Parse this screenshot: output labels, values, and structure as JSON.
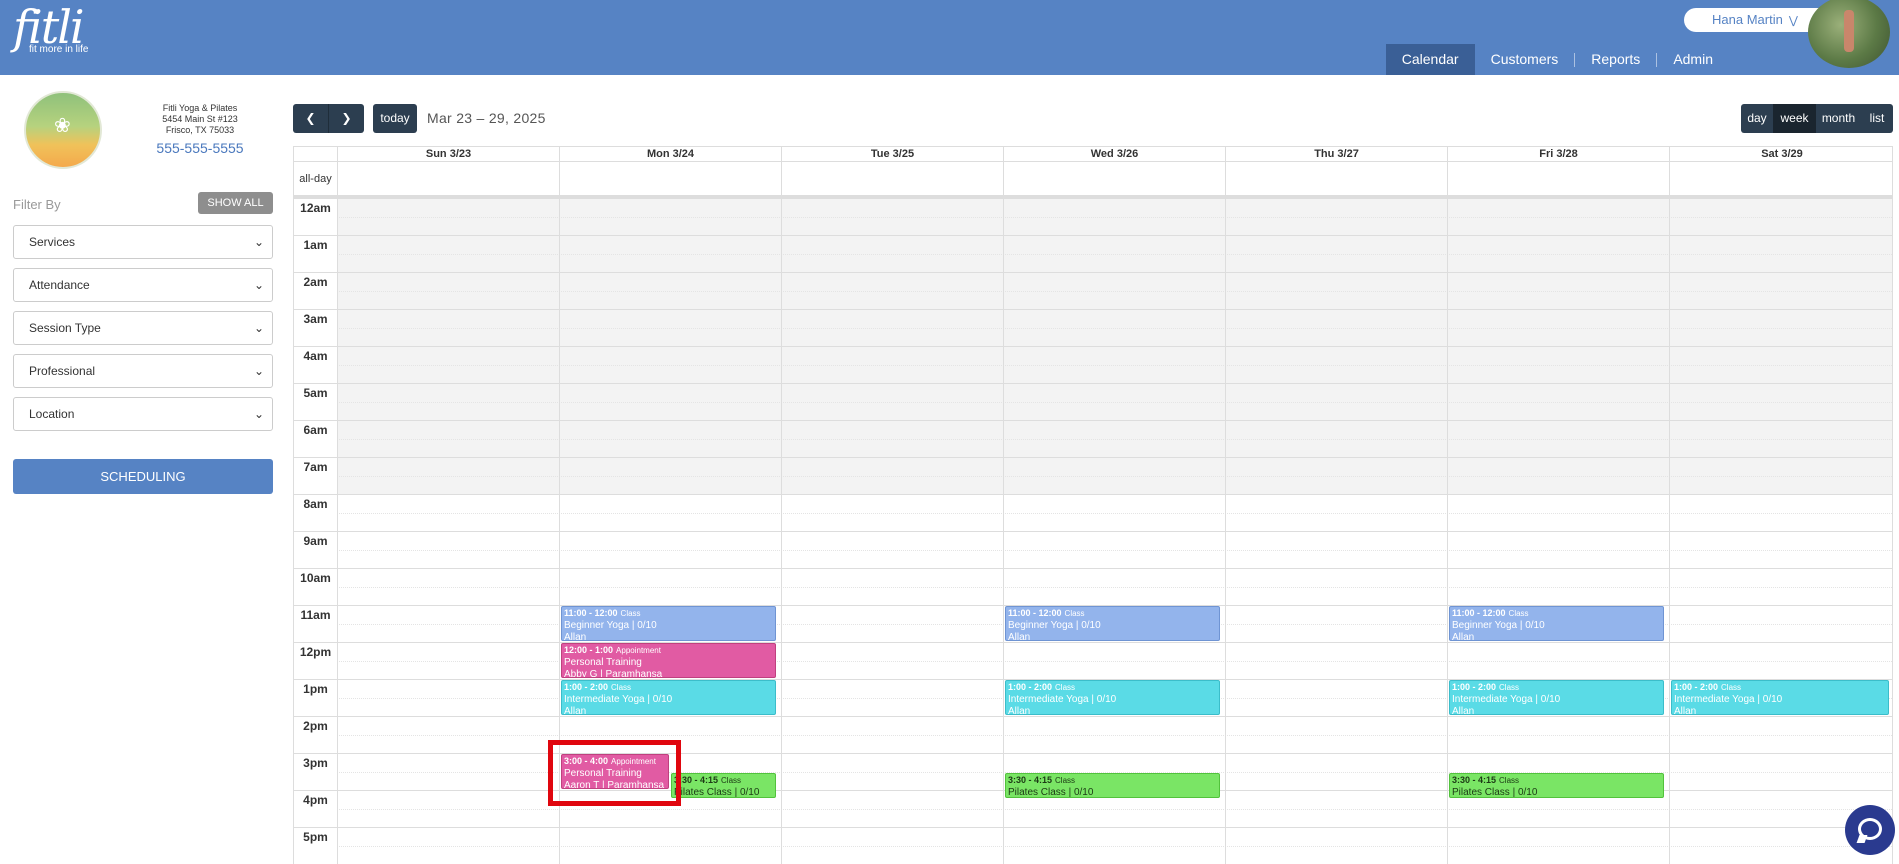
{
  "header": {
    "logo_word": "fitli",
    "logo_tagline": "fit more in life",
    "user_name": "Hana Martin",
    "user_menu_icon": "double-chevron-down-icon",
    "nav": [
      "Calendar",
      "Customers",
      "Reports",
      "Admin"
    ],
    "active_nav": "Calendar",
    "bg_color": "#5683c4"
  },
  "sidebar": {
    "studio_name": "Fitli Yoga & Pilates",
    "studio_address1": "5454 Main St #123",
    "studio_address2": "Frisco, TX 75033",
    "studio_phone": "555-555-5555",
    "filter_label": "Filter By",
    "show_all_label": "SHOW ALL",
    "filters": [
      "Services",
      "Attendance",
      "Session Type",
      "Professional",
      "Location"
    ],
    "scheduling_label": "SCHEDULING"
  },
  "toolbar": {
    "prev_icon": "chevron-left-icon",
    "next_icon": "chevron-right-icon",
    "today_label": "today",
    "range_title": "Mar 23 – 29, 2025",
    "views": [
      "day",
      "week",
      "month",
      "list"
    ],
    "active_view": "week"
  },
  "calendar": {
    "allday_label": "all-day",
    "days": [
      "Sun 3/23",
      "Mon 3/24",
      "Tue 3/25",
      "Wed 3/26",
      "Thu 3/27",
      "Fri 3/28",
      "Sat 3/29"
    ],
    "time_labels": [
      "12am",
      "1am",
      "2am",
      "3am",
      "4am",
      "5am",
      "6am",
      "7am",
      "8am",
      "9am",
      "10am",
      "11am",
      "12pm",
      "1pm",
      "2pm",
      "3pm",
      "4pm",
      "5pm"
    ],
    "events": [
      {
        "day": 1,
        "time": "11:00 - 12:00",
        "kind": "Class",
        "title": "Beginner Yoga | 0/10",
        "who": "Allan",
        "style": "beginner"
      },
      {
        "day": 1,
        "time": "12:00 - 1:00",
        "kind": "Appointment",
        "title": "Personal Training",
        "who": "Abby G | Paramhansa",
        "style": "pt"
      },
      {
        "day": 1,
        "time": "1:00 - 2:00",
        "kind": "Class",
        "title": "Intermediate Yoga | 0/10",
        "who": "Allan",
        "style": "inter"
      },
      {
        "day": 1,
        "time": "3:00 - 4:00",
        "kind": "Appointment",
        "title": "Personal Training",
        "who": "Aaron T | Paramhansa",
        "style": "pt"
      },
      {
        "day": 1,
        "time": "3:30 - 4:15",
        "kind": "Class",
        "title": "Pilates Class | 0/10",
        "who": "",
        "style": "pilates"
      },
      {
        "day": 3,
        "time": "11:00 - 12:00",
        "kind": "Class",
        "title": "Beginner Yoga | 0/10",
        "who": "Allan",
        "style": "beginner"
      },
      {
        "day": 3,
        "time": "1:00 - 2:00",
        "kind": "Class",
        "title": "Intermediate Yoga | 0/10",
        "who": "Allan",
        "style": "inter"
      },
      {
        "day": 3,
        "time": "3:30 - 4:15",
        "kind": "Class",
        "title": "Pilates Class | 0/10",
        "who": "",
        "style": "pilates"
      },
      {
        "day": 5,
        "time": "11:00 - 12:00",
        "kind": "Class",
        "title": "Beginner Yoga | 0/10",
        "who": "Allan",
        "style": "beginner"
      },
      {
        "day": 5,
        "time": "1:00 - 2:00",
        "kind": "Class",
        "title": "Intermediate Yoga | 0/10",
        "who": "Allan",
        "style": "inter"
      },
      {
        "day": 5,
        "time": "3:30 - 4:15",
        "kind": "Class",
        "title": "Pilates Class | 0/10",
        "who": "",
        "style": "pilates"
      },
      {
        "day": 6,
        "time": "1:00 - 2:00",
        "kind": "Class",
        "title": "Intermediate Yoga | 0/10",
        "who": "Allan",
        "style": "inter"
      }
    ]
  },
  "chat_icon": "chat-bubble-icon"
}
